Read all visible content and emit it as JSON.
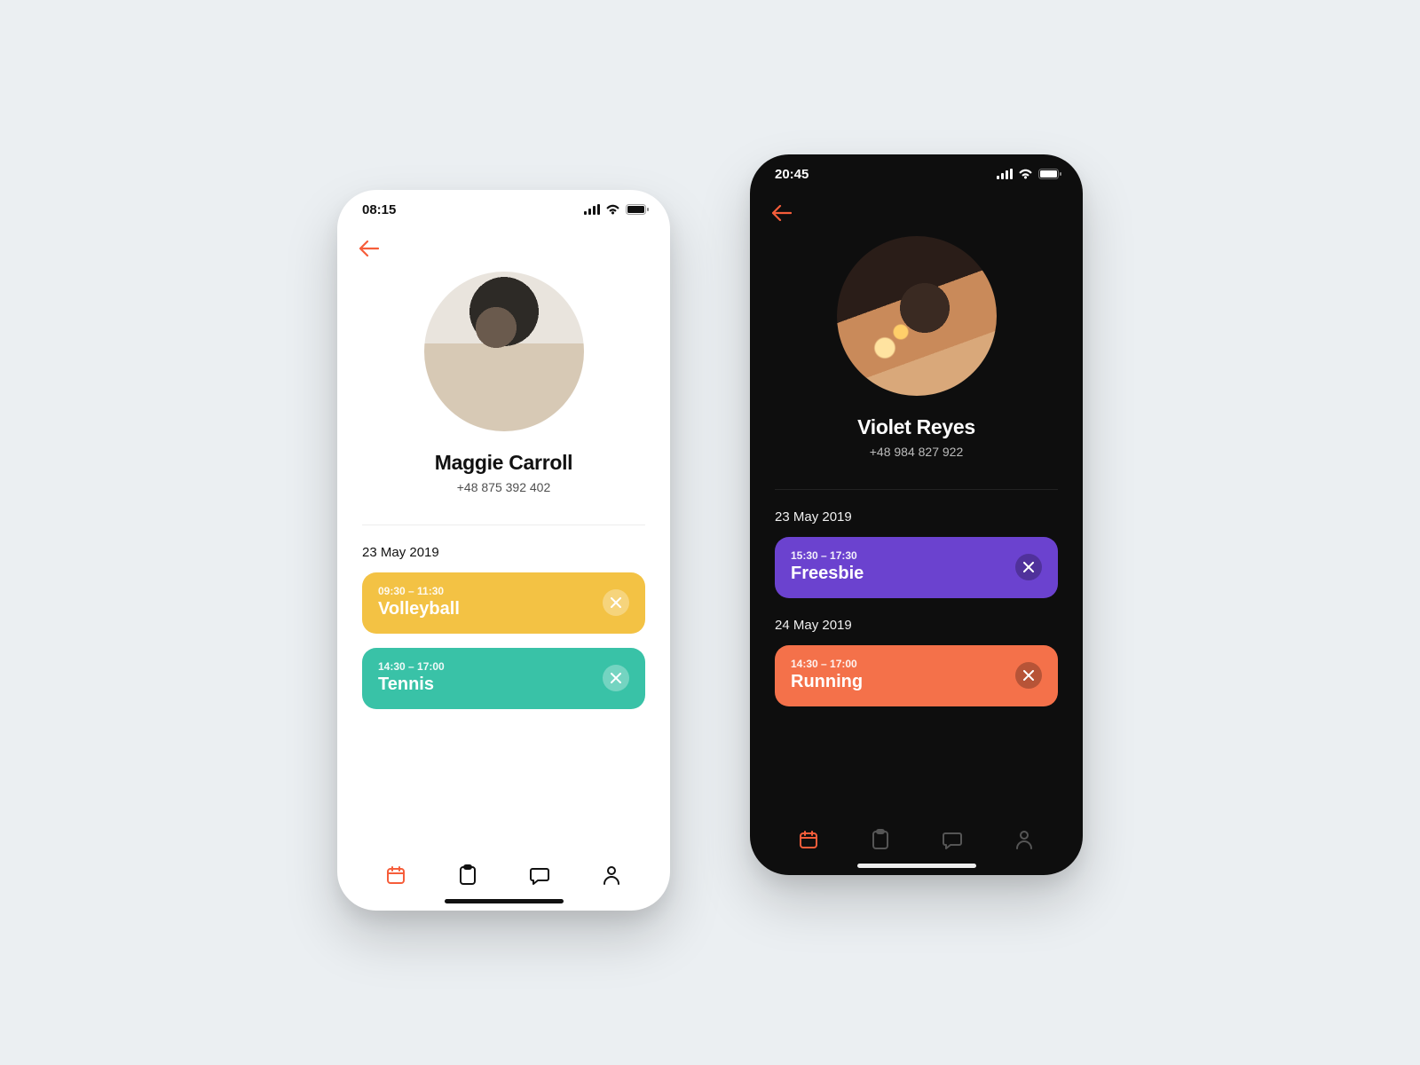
{
  "colors": {
    "accent": "#f65d3a",
    "yellow": "#f3c244",
    "teal": "#39c2a7",
    "purple": "#6b42cf",
    "orange": "#f4714a"
  },
  "phones": [
    {
      "theme": "light",
      "status_time": "08:15",
      "profile": {
        "name": "Maggie Carroll",
        "phone": "+48 875 392 402"
      },
      "sections": [
        {
          "date": "23 May 2019",
          "events": [
            {
              "time": "09:30 – 11:30",
              "title": "Volleyball",
              "color": "yellow"
            },
            {
              "time": "14:30 – 17:00",
              "title": "Tennis",
              "color": "teal"
            }
          ]
        }
      ]
    },
    {
      "theme": "dark",
      "status_time": "20:45",
      "profile": {
        "name": "Violet Reyes",
        "phone": "+48 984 827 922"
      },
      "sections": [
        {
          "date": "23 May 2019",
          "events": [
            {
              "time": "15:30 – 17:30",
              "title": "Freesbie",
              "color": "purple"
            }
          ]
        },
        {
          "date": "24 May 2019",
          "events": [
            {
              "time": "14:30 – 17:00",
              "title": "Running",
              "color": "orange"
            }
          ]
        }
      ]
    }
  ],
  "tabbar": [
    "calendar",
    "clipboard",
    "chat",
    "profile"
  ]
}
